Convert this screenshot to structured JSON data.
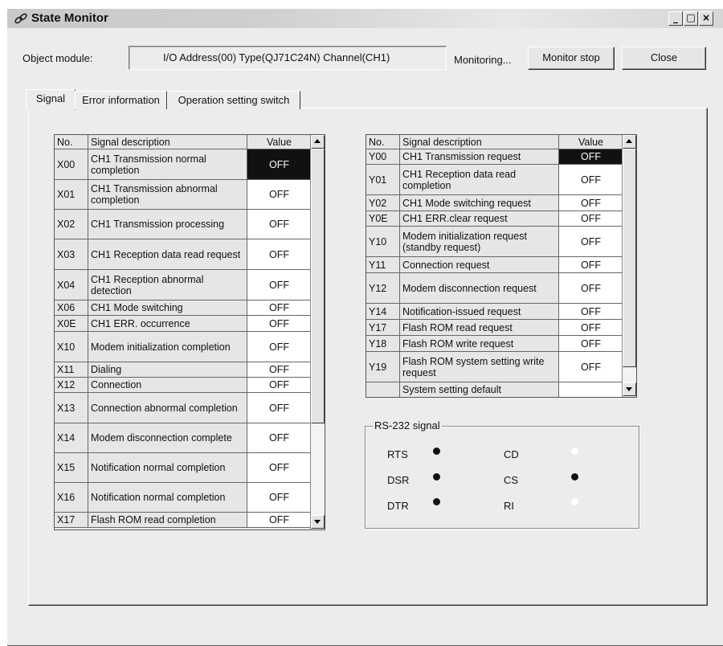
{
  "window": {
    "title": "State Monitor"
  },
  "header": {
    "object_module_label": "Object module:",
    "object_module_value": "I/O Address(00) Type(QJ71C24N) Channel(CH1)",
    "status_text": "Monitoring...",
    "monitor_stop_label": "Monitor stop",
    "close_label": "Close"
  },
  "tabs": [
    {
      "label": "Signal",
      "active": true
    },
    {
      "label": "Error information",
      "active": false
    },
    {
      "label": "Operation setting switch",
      "active": false
    }
  ],
  "x_table": {
    "headers": [
      "No.",
      "Signal description",
      "Value"
    ],
    "rows": [
      {
        "no": "X00",
        "desc": "CH1 Transmission normal completion",
        "value": "OFF",
        "selected": true
      },
      {
        "no": "X01",
        "desc": "CH1 Transmission abnormal completion",
        "value": "OFF"
      },
      {
        "no": "X02",
        "desc": "CH1 Transmission processing",
        "value": "OFF"
      },
      {
        "no": "X03",
        "desc": "CH1 Reception data read request",
        "value": "OFF"
      },
      {
        "no": "X04",
        "desc": "CH1 Reception abnormal detection",
        "value": "OFF"
      },
      {
        "no": "X06",
        "desc": "CH1 Mode switching",
        "value": "OFF"
      },
      {
        "no": "X0E",
        "desc": "CH1 ERR. occurrence",
        "value": "OFF"
      },
      {
        "no": "X10",
        "desc": "Modem initialization completion",
        "value": "OFF"
      },
      {
        "no": "X11",
        "desc": "Dialing",
        "value": "OFF"
      },
      {
        "no": "X12",
        "desc": "Connection",
        "value": "OFF"
      },
      {
        "no": "X13",
        "desc": "Connection abnormal completion",
        "value": "OFF"
      },
      {
        "no": "X14",
        "desc": "Modem disconnection complete",
        "value": "OFF"
      },
      {
        "no": "X15",
        "desc": "Notification normal completion",
        "value": "OFF"
      },
      {
        "no": "X16",
        "desc": "Notification normal completion",
        "value": "OFF"
      },
      {
        "no": "X17",
        "desc": "Flash ROM read completion",
        "value": "OFF"
      }
    ]
  },
  "y_table": {
    "headers": [
      "No.",
      "Signal description",
      "Value"
    ],
    "rows": [
      {
        "no": "Y00",
        "desc": "CH1 Transmission request",
        "value": "OFF",
        "selected": true
      },
      {
        "no": "Y01",
        "desc": "CH1 Reception data read completion",
        "value": "OFF"
      },
      {
        "no": "Y02",
        "desc": "CH1 Mode switching request",
        "value": "OFF"
      },
      {
        "no": "Y0E",
        "desc": "CH1 ERR.clear request",
        "value": "OFF"
      },
      {
        "no": "Y10",
        "desc": "Modem initialization request (standby request)",
        "value": "OFF"
      },
      {
        "no": "Y11",
        "desc": "Connection request",
        "value": "OFF"
      },
      {
        "no": "Y12",
        "desc": "Modem disconnection request",
        "value": "OFF"
      },
      {
        "no": "Y14",
        "desc": "Notification-issued request",
        "value": "OFF"
      },
      {
        "no": "Y17",
        "desc": "Flash ROM read request",
        "value": "OFF"
      },
      {
        "no": "Y18",
        "desc": "Flash ROM write request",
        "value": "OFF"
      },
      {
        "no": "Y19",
        "desc": "Flash ROM system setting write request",
        "value": "OFF"
      },
      {
        "no": "",
        "desc": "System setting default",
        "value": ""
      }
    ]
  },
  "rs232": {
    "title": "RS-232 signal",
    "signals": [
      {
        "label": "RTS",
        "on": true
      },
      {
        "label": "CD",
        "on": false
      },
      {
        "label": "DSR",
        "on": true
      },
      {
        "label": "CS",
        "on": true
      },
      {
        "label": "DTR",
        "on": true
      },
      {
        "label": "RI",
        "on": false
      }
    ]
  },
  "colors": {
    "led_on": "#111111",
    "led_off": "#ffffff",
    "selected_cell": "#111111"
  }
}
